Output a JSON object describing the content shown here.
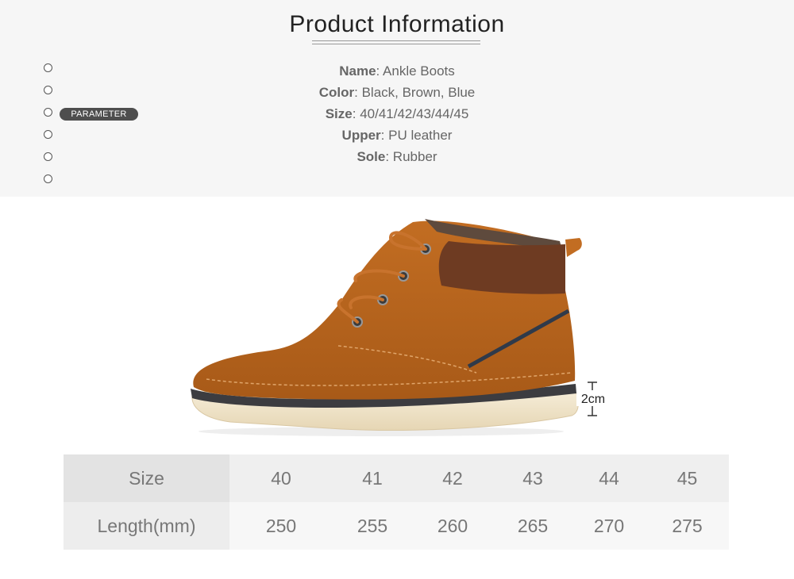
{
  "title": "Product Information",
  "tab_label": "PARAMETER",
  "specs": [
    {
      "key": "Name",
      "value": "Ankle Boots"
    },
    {
      "key": "Color",
      "value": "Black, Brown, Blue"
    },
    {
      "key": "Size",
      "value": "40/41/42/43/44/45"
    },
    {
      "key": "Upper",
      "value": "PU leather"
    },
    {
      "key": "Sole",
      "value": "Rubber"
    }
  ],
  "image": {
    "subject": "ankle-boot-brown",
    "dimension_label": "2cm"
  },
  "size_table": {
    "row1": {
      "header": "Size",
      "cells": [
        "40",
        "41",
        "42",
        "43",
        "44",
        "45"
      ]
    },
    "row2": {
      "header": "Length(mm)",
      "cells": [
        "250",
        "255",
        "260",
        "265",
        "270",
        "275"
      ]
    }
  },
  "colors": {
    "band": "#f6f6f6",
    "tag": "#4e4e4e",
    "suede": "#b8661f",
    "leather": "#6e3b22",
    "sole": "#efe3c8"
  }
}
